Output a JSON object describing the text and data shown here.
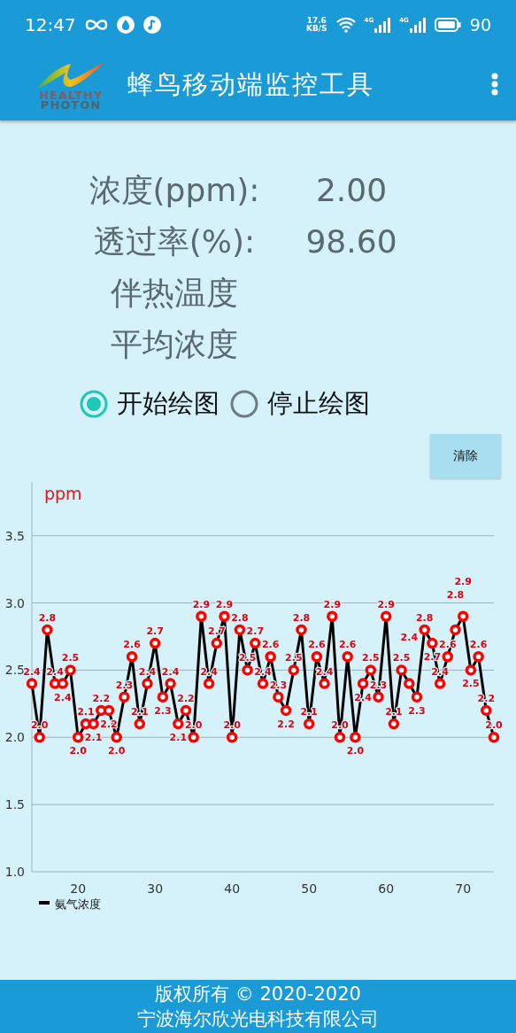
{
  "status_bar": {
    "time": "12:47",
    "net_speed_value": "17.6",
    "net_speed_unit": "KB/S",
    "signals": [
      {
        "label": "4G"
      },
      {
        "label": "4G"
      }
    ],
    "battery": "90"
  },
  "app_bar": {
    "logo_lines": [
      "HEALTHY",
      "PHOTON"
    ],
    "title": "蜂鸟移动端监控工具"
  },
  "readings": [
    {
      "label": "浓度(ppm):",
      "value": "2.00"
    },
    {
      "label": "透过率(%):",
      "value": "98.60"
    },
    {
      "label": "伴热温度"
    },
    {
      "label": "平均浓度"
    }
  ],
  "plot_mode": [
    {
      "label": "开始绘图",
      "selected": true
    },
    {
      "label": "停止绘图",
      "selected": false
    }
  ],
  "clear_button": "清除",
  "chart": {
    "chart_data": {
      "type": "line",
      "ylabel": "ppm",
      "xlim": [
        14,
        74
      ],
      "ylim": [
        1.0,
        3.9
      ],
      "xticks": [
        20,
        30,
        40,
        50,
        60,
        70
      ],
      "yticks": [
        {
          "value": 1.0,
          "label": "1.0"
        },
        {
          "value": 1.5,
          "label": "1.5"
        },
        {
          "value": 2.0,
          "label": "2.0"
        },
        {
          "value": 2.5,
          "label": "2.5"
        },
        {
          "value": 3.0,
          "label": "3.0"
        },
        {
          "value": 3.5,
          "label": "3.5"
        }
      ],
      "grid": true,
      "value_labels": [
        "2.4",
        "2.0",
        "2.8",
        "2.4",
        "2.4",
        "2.5",
        "2.0",
        "2.1",
        "2.1",
        "2.2",
        "2.2",
        "2.0",
        "2.3",
        "2.6",
        "2.1",
        "2.4",
        "2.7",
        "2.3",
        "2.4",
        "2.1",
        "2.2",
        "2.0",
        "2.9",
        "2.4",
        "2.7",
        "2.9",
        "2.0",
        "2.8",
        "2.5",
        "2.7",
        "2.4",
        "2.6",
        "2.3",
        "2.2",
        "2.5",
        "2.8",
        "2.1",
        "2.6",
        "2.4",
        "2.9",
        "2.0",
        "2.6",
        "2.0",
        "2.4",
        "2.5",
        "2.3",
        "2.9",
        "2.1",
        "2.5",
        "2.4",
        "2.3",
        "2.8",
        "2.7",
        "2.4",
        "2.6",
        "2.8",
        "2.9",
        "2.5",
        "2.6",
        "2.2",
        "2.0"
      ],
      "x": [
        14,
        15,
        16,
        17,
        18,
        19,
        20,
        21,
        22,
        23,
        24,
        25,
        26,
        27,
        28,
        29,
        30,
        31,
        32,
        33,
        34,
        35,
        36,
        37,
        38,
        39,
        40,
        41,
        42,
        43,
        44,
        45,
        46,
        47,
        48,
        49,
        50,
        51,
        52,
        53,
        54,
        55,
        56,
        57,
        58,
        59,
        60,
        61,
        62,
        63,
        64,
        65,
        66,
        67,
        68,
        69,
        70,
        71,
        72,
        73,
        74
      ],
      "series": [
        {
          "name": "氨气浓度",
          "color": "#000000",
          "marker": "circle",
          "values": [
            2.4,
            2.0,
            2.8,
            2.4,
            2.4,
            2.5,
            2.0,
            2.1,
            2.1,
            2.2,
            2.2,
            2.0,
            2.3,
            2.6,
            2.1,
            2.4,
            2.7,
            2.3,
            2.4,
            2.1,
            2.2,
            2.0,
            2.9,
            2.4,
            2.7,
            2.9,
            2.0,
            2.8,
            2.5,
            2.7,
            2.4,
            2.6,
            2.3,
            2.2,
            2.5,
            2.8,
            2.1,
            2.6,
            2.4,
            2.9,
            2.0,
            2.6,
            2.0,
            2.4,
            2.5,
            2.3,
            2.9,
            2.1,
            2.5,
            2.4,
            2.3,
            2.8,
            2.7,
            2.4,
            2.6,
            2.8,
            2.9,
            2.5,
            2.6,
            2.2,
            2.0
          ]
        }
      ]
    }
  },
  "footer": [
    "版权所有 © 2020-2020",
    "宁波海尔欣光电科技有限公司"
  ]
}
